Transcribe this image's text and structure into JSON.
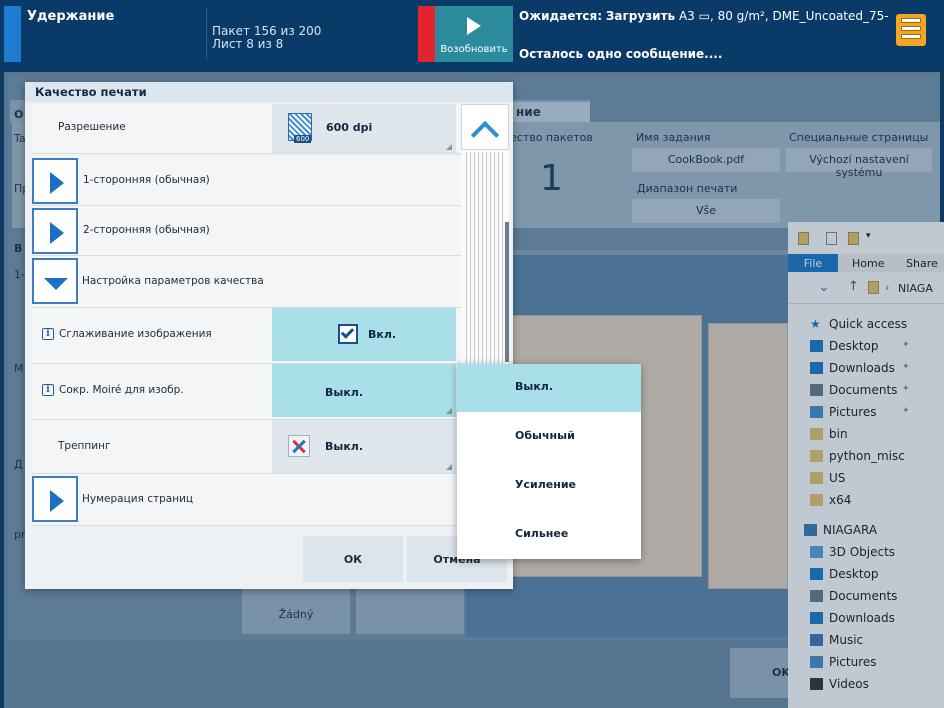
{
  "topbar": {
    "status_title": "Удержание",
    "batch_line": "Пакет 156 из 200",
    "sheet_line": "Лист 8 из 8",
    "resume_label": "Возобновить",
    "expected_prefix": "Ожидается:",
    "expected_action": "Загрузить",
    "expected_media": "A3 ▭, 80 g/m², DME_Uncoated_75-",
    "messages": "Осталось одно сообщение....",
    "menu_icon": "stack-menu-icon"
  },
  "background": {
    "tab_right_label": "ние",
    "batches_label": "ество пакетов",
    "batches_value": "1",
    "job_name_label": "Имя задания",
    "job_name_value": "CookBook.pdf",
    "special_pages_label": "Специальные страницы",
    "special_pages_value": "Výchozí nastavení systému",
    "print_range_label": "Диапазон печати",
    "print_range_value": "Vše",
    "left_fragments": [
      "O",
      "Ta",
      "Пр",
      "B",
      "1-",
      "M",
      "Д",
      "pr"
    ],
    "tile_none_label": "Žádný",
    "ok_fragment": "OK"
  },
  "explorer": {
    "tabs": {
      "file": "File",
      "home": "Home",
      "share": "Share"
    },
    "path_label": "NIAGA",
    "tree": [
      {
        "label": "Quick access",
        "icon": "star-icon",
        "pinned": false
      },
      {
        "label": "Desktop",
        "icon": "desktop-icon",
        "pinned": true
      },
      {
        "label": "Downloads",
        "icon": "download-icon",
        "pinned": true
      },
      {
        "label": "Documents",
        "icon": "documents-icon",
        "pinned": true
      },
      {
        "label": "Pictures",
        "icon": "pictures-icon",
        "pinned": true
      },
      {
        "label": "bin",
        "icon": "folder-icon",
        "pinned": false
      },
      {
        "label": "python_misc",
        "icon": "folder-icon",
        "pinned": false
      },
      {
        "label": "US",
        "icon": "folder-icon",
        "pinned": false
      },
      {
        "label": "x64",
        "icon": "folder-icon",
        "pinned": false
      },
      {
        "label": "NIAGARA",
        "icon": "computer-icon",
        "pinned": false
      },
      {
        "label": "3D Objects",
        "icon": "cube-icon",
        "pinned": false
      },
      {
        "label": "Desktop",
        "icon": "desktop-icon",
        "pinned": false
      },
      {
        "label": "Documents",
        "icon": "documents-icon",
        "pinned": false
      },
      {
        "label": "Downloads",
        "icon": "download-icon",
        "pinned": false
      },
      {
        "label": "Music",
        "icon": "music-icon",
        "pinned": false
      },
      {
        "label": "Pictures",
        "icon": "pictures-icon",
        "pinned": false
      },
      {
        "label": "Videos",
        "icon": "videos-icon",
        "pinned": false
      }
    ]
  },
  "dialog": {
    "title": "Качество печати",
    "resolution_label": "Разрешение",
    "resolution_value": "600 dpi",
    "resolution_icon_text": "600",
    "simplex_label": "1-сторонняя (обычная)",
    "duplex_label": "2-сторонняя (обычная)",
    "quality_settings_label": "Настройка параметров качества",
    "smoothing_label": "Сглаживание изображения",
    "smoothing_value": "Вкл.",
    "moire_label": "Сокр. Moiré для изобр.",
    "moire_value": "Выкл.",
    "trapping_label": "Треппинг",
    "trapping_value": "Выкл.",
    "page_numbering_label": "Нумерация страниц",
    "info_glyph": "i",
    "ok_label": "ОК",
    "cancel_label": "Отмена"
  },
  "dropdown": {
    "options": [
      "Выкл.",
      "Обычный",
      "Усиление",
      "Сильнее"
    ],
    "selected_index": 0
  },
  "colors": {
    "topbar": "#0a3a68",
    "hold_accent": "#1f7bd0",
    "alert_accent": "#e4232f",
    "resume_button": "#2b8a9c",
    "menu_button": "#f3a623",
    "highlight": "#a9dfe8",
    "explorer_file_tab": "#1979ca"
  }
}
